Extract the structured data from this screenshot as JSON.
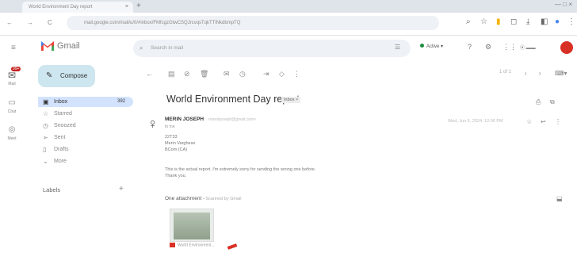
{
  "browser": {
    "tab_title": "World Environment Day report",
    "close_tab": "×",
    "new_tab": "+",
    "window_controls": "— □ ×",
    "back": "←",
    "forward": "→",
    "reload": "C",
    "url": "mail.google.com/mail/u/0/#inbox/FMfcgzGtwCSQJrcvqsTqkTTlNkdbmpTQ"
  },
  "gmail": {
    "logo_text": "Gmail",
    "search_placeholder": "Search in mail",
    "status": "Active",
    "avatar_letter": "",
    "rail": {
      "mail": "Mail",
      "chat": "Chat",
      "meet": "Meet",
      "badge": "99+"
    },
    "compose": "Compose",
    "nav": [
      {
        "label": "Inbox",
        "count": "392"
      },
      {
        "label": "Starred",
        "count": ""
      },
      {
        "label": "Snoozed",
        "count": ""
      },
      {
        "label": "Sent",
        "count": ""
      },
      {
        "label": "Drafts",
        "count": ""
      },
      {
        "label": "More",
        "count": ""
      }
    ],
    "labels_title": "Labels",
    "pager": "1 of 1"
  },
  "email": {
    "subject": "World Environment Day report",
    "tag": "Inbox ×",
    "sender": "MERIN JOSEPH",
    "sender_email": "<merinjoseph@gmail.com>",
    "to": "to me",
    "date": "Wed, Jun 5, 2024, 12:06 PM",
    "body": [
      "22T33",
      "Merin Varghese",
      "BCom (CA)",
      "",
      "This is the actual report. I'm extremely sorry for sending the wrong one before.",
      "Thank you."
    ],
    "attachment_title": "One attachment",
    "attachment_sub": "• Scanned by Gmail",
    "attachment_name": "World Environment..."
  },
  "colors": {
    "accent": "#d93025",
    "compose_bg": "#cde6ef",
    "selected_nav": "#d3e3fd"
  }
}
